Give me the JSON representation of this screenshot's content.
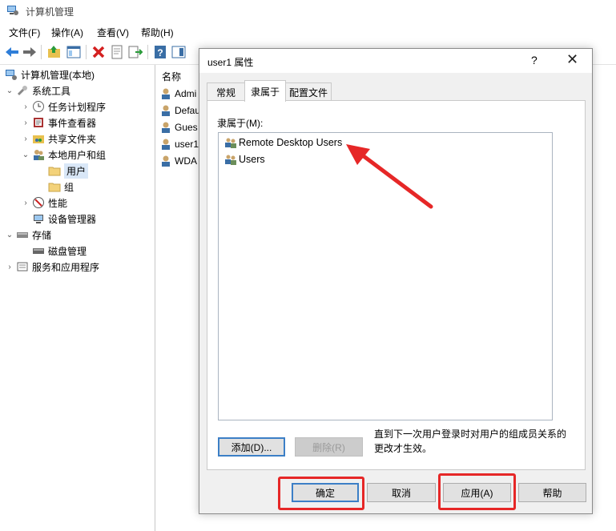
{
  "window": {
    "title": "计算机管理"
  },
  "menu": [
    "文件(F)",
    "操作(A)",
    "查看(V)",
    "帮助(H)"
  ],
  "toolbar": [
    "back-icon",
    "forward-icon",
    "up-folder-icon",
    "show-tree-icon",
    "delete-icon",
    "properties-icon",
    "export-icon",
    "help-icon",
    "action-pane-icon"
  ],
  "tree": {
    "root": "计算机管理(本地)",
    "system_tools": "系统工具",
    "task_scheduler": "任务计划程序",
    "event_viewer": "事件查看器",
    "shared_folders": "共享文件夹",
    "local_users": "本地用户和组",
    "users": "用户",
    "groups": "组",
    "performance": "性能",
    "device_manager": "设备管理器",
    "storage": "存储",
    "disk_management": "磁盘管理",
    "services": "服务和应用程序"
  },
  "list": {
    "header": "名称",
    "rows": [
      "Admi",
      "Defau",
      "Gues",
      "user1",
      "WDA"
    ]
  },
  "dialog": {
    "title": "user1 属性",
    "help": "?",
    "close": "✕",
    "tabs": [
      "常规",
      "隶属于",
      "配置文件"
    ],
    "member_of_label": "隶属于(M):",
    "members": [
      "Remote Desktop Users",
      "Users"
    ],
    "add_button": "添加(D)...",
    "remove_button": "删除(R)",
    "note": "直到下一次用户登录时对用户的组成员关系的更改才生效。",
    "ok_button": "确定",
    "cancel_button": "取消",
    "apply_button": "应用(A)",
    "help_button": "帮助"
  },
  "colors": {
    "highlight": "#e62727",
    "accent": "#3c7fc6"
  }
}
